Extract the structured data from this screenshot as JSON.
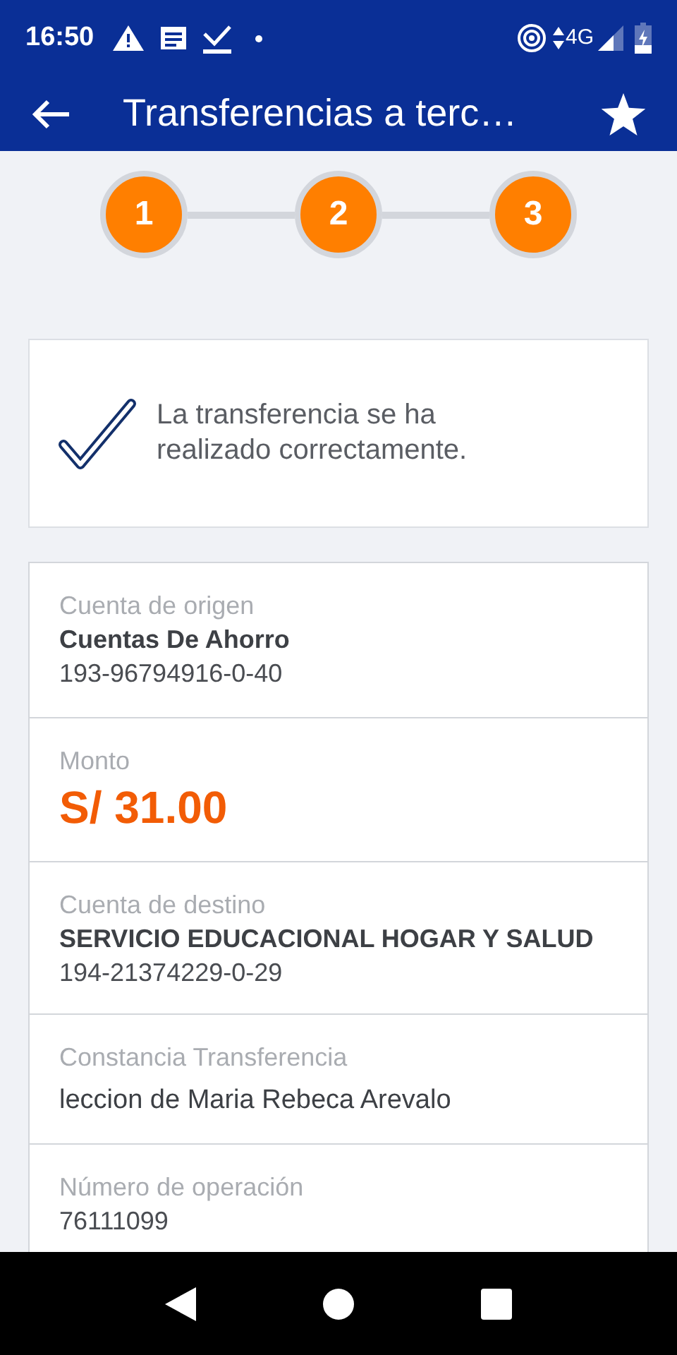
{
  "status_bar": {
    "time": "16:50",
    "network": "4G"
  },
  "app_bar": {
    "title": "Transferencias a terc…"
  },
  "steps": [
    {
      "label": "1"
    },
    {
      "label": "2"
    },
    {
      "label": "3"
    }
  ],
  "message": {
    "text": "La transferencia se ha realizado correctamente."
  },
  "details": [
    {
      "label": "Cuenta de origen",
      "lines": [
        {
          "kind": "name",
          "text": "Cuentas De Ahorro"
        },
        {
          "kind": "text",
          "text": "193-96794916-0-40"
        }
      ]
    },
    {
      "label": "Monto",
      "lines": [
        {
          "kind": "amount",
          "text": "S/ 31.00"
        }
      ]
    },
    {
      "label": "Cuenta de destino",
      "lines": [
        {
          "kind": "name",
          "text": "SERVICIO EDUCACIONAL HOGAR Y SALUD"
        },
        {
          "kind": "text",
          "text": "194-21374229-0-29"
        }
      ]
    },
    {
      "label": "Constancia Transferencia",
      "lines": [
        {
          "kind": "note",
          "text": "leccion de Maria Rebeca Arevalo"
        }
      ]
    },
    {
      "label": "Número de operación",
      "lines": [
        {
          "kind": "text",
          "text": "76111099"
        }
      ]
    }
  ]
}
